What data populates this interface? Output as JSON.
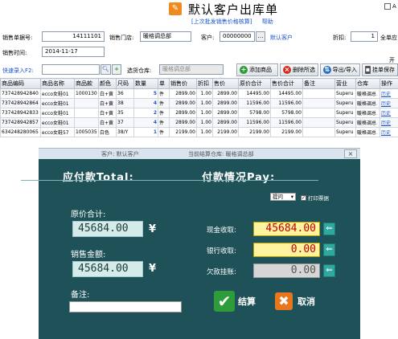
{
  "header": {
    "title": "默认客户出库单",
    "sub_link": "[上次批发销售价格核算]",
    "help_link": "帮助",
    "right_check_label": "A"
  },
  "form": {
    "order_no_label": "销售单据号:",
    "order_no_value": "14111101",
    "store_label": "销售门店:",
    "store_value": "暖格调总部",
    "customer_label": "客户:",
    "customer_value": "00000000",
    "customer_name": "默认客户",
    "discount_label": "折扣:",
    "discount_value": "1",
    "full_order_label": "全单应",
    "date_label": "销售时间:",
    "date_value": "2014-11-17",
    "quick_entry_label": "快速录入F2:",
    "warehouse_label": "选货仓库:",
    "warehouse_value": "暖格调总部"
  },
  "toolbar": {
    "add_label": "添加商品",
    "delete_label": "删除所选",
    "import_label": "导出/导入",
    "hold_label": "挂单保存",
    "extra_label": "开"
  },
  "table": {
    "headers": [
      "商品编码",
      "商品名称",
      "商品款",
      "颜色",
      "尺码",
      "数量",
      "单",
      "销售价",
      "折扣",
      "售价",
      "原价合计",
      "售价合计",
      "备注",
      "营业",
      "仓库",
      "操作"
    ],
    "rows": [
      {
        "code": "737428942840",
        "name": "ecco女鞋01",
        "style": "1000130",
        "color": "白+黄",
        "size": "36",
        "qty": "5",
        "unit": "件",
        "price": "2899.00",
        "disc": "1.00",
        "sale": "2899.00",
        "orig_total": "14495.00",
        "sale_total": "14495.00",
        "note": "",
        "biz": "Superu",
        "wh": "暖格调总",
        "op": "历史"
      },
      {
        "code": "737428942864",
        "name": "ecco女鞋01",
        "style": "",
        "color": "白+黄",
        "size": "38",
        "qty": "4",
        "unit": "件",
        "price": "2899.00",
        "disc": "1.00",
        "sale": "2899.00",
        "orig_total": "11596.00",
        "sale_total": "11596.00",
        "note": "",
        "biz": "Superu",
        "wh": "暖格调总",
        "op": "历史"
      },
      {
        "code": "737428942833",
        "name": "ecco女鞋01",
        "style": "",
        "color": "白+黄",
        "size": "35",
        "qty": "2",
        "unit": "件",
        "price": "2899.00",
        "disc": "1.00",
        "sale": "2899.00",
        "orig_total": "5798.00",
        "sale_total": "5798.00",
        "note": "",
        "biz": "Superu",
        "wh": "暖格调总",
        "op": "历史"
      },
      {
        "code": "737428942857",
        "name": "ecco女鞋01",
        "style": "",
        "color": "白+黄",
        "size": "37",
        "qty": "4",
        "unit": "件",
        "price": "2899.00",
        "disc": "1.00",
        "sale": "2899.00",
        "orig_total": "11596.00",
        "sale_total": "11596.00",
        "note": "",
        "biz": "Superu",
        "wh": "暖格调总",
        "op": "历史"
      },
      {
        "code": "634248280065",
        "name": "ecco女鞋57",
        "style": "1005035",
        "color": "白色",
        "size": "38/Y",
        "qty": "1",
        "unit": "件",
        "price": "2199.00",
        "disc": "1.00",
        "sale": "2199.00",
        "orig_total": "2199.00",
        "sale_total": "2199.00",
        "note": "",
        "biz": "Superu",
        "wh": "暖格调总",
        "op": "历史"
      }
    ]
  },
  "dialog": {
    "bar_customer": "客户: 默认客户",
    "bar_warehouse": "当前结算仓库: 暖格调总部",
    "total_title": "应付款Total:",
    "pay_title": "付款情况Pay:",
    "select_value": "提问",
    "print_label": "打印票据",
    "orig_total_label": "原价合计:",
    "orig_total_value": "45684.00",
    "sales_amount_label": "销售金额:",
    "sales_amount_value": "45684.00",
    "yen": "¥",
    "cash_label": "现金收取:",
    "cash_value": "45684.00",
    "bank_label": "银行收取:",
    "bank_value": "0.00",
    "owe_label": "欠款挂账:",
    "owe_value": "0.00",
    "note_label": "备注:",
    "ok_label": "结算",
    "cancel_label": "取消"
  }
}
